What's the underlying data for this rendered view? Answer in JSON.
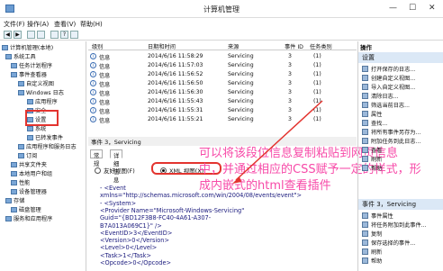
{
  "window": {
    "title": "计算机管理",
    "minimize": "—",
    "maximize": "☐",
    "close": "✕"
  },
  "menu": [
    "文件(F)",
    "操作(A)",
    "查看(V)",
    "帮助(H)"
  ],
  "tree": [
    "计算机管理(本地)",
    "系统工具",
    "任务计划程序",
    "事件查看器",
    "自定义视图",
    "Windows 日志",
    "应用程序",
    "安全",
    "设置",
    "系统",
    "已转发事件",
    "应用程序和服务日志",
    "订阅",
    "共享文件夹",
    "本地用户和组",
    "性能",
    "设备管理器",
    "存储",
    "磁盘管理",
    "服务和应用程序"
  ],
  "grid": {
    "headers": [
      "级别",
      "日期和时间",
      "来源",
      "事件 ID",
      "任务类别"
    ],
    "rows": [
      [
        "信息",
        "2014/6/16 11:58:29",
        "Servicing",
        "3",
        "(1)"
      ],
      [
        "信息",
        "2014/6/16 11:57:03",
        "Servicing",
        "3",
        "(1)"
      ],
      [
        "信息",
        "2014/6/16 11:56:52",
        "Servicing",
        "3",
        "(1)"
      ],
      [
        "信息",
        "2014/6/16 11:56:50",
        "Servicing",
        "3",
        "(1)"
      ],
      [
        "信息",
        "2014/6/16 11:56:30",
        "Servicing",
        "3",
        "(1)"
      ],
      [
        "信息",
        "2014/6/16 11:55:43",
        "Servicing",
        "3",
        "(1)"
      ],
      [
        "信息",
        "2014/6/16 11:55:31",
        "Servicing",
        "3",
        "(1)"
      ],
      [
        "信息",
        "2014/6/16 11:55:21",
        "Servicing",
        "3",
        "(1)"
      ]
    ]
  },
  "detail": {
    "header": "事件 3，Servicing",
    "tabs": [
      "常规",
      "详细信息"
    ],
    "radio_friendly": "友好视图(F)",
    "radio_xml": "XML 视图(X)"
  },
  "xml_lines": [
    "- <Event",
    "  xmlns=\"http://schemas.microsoft.com/win/2004/08/events/event\">",
    "- <System>",
    "    <Provider Name=\"Microsoft-Windows-Servicing\"",
    "     Guid=\"{BD12F3B8-FC40-4A61-A307-",
    "     B7A013A069C1}\" />",
    "    <EventID>3</EventID>",
    "    <Version>0</Version>",
    "    <Level>0</Level>",
    "    <Task>1</Task>",
    "    <Opcode>0</Opcode>"
  ],
  "overlay": [
    "可以将该段位信息复制粘贴到网页信息",
    "中，并通过相应的CSS赋予一定的样式，形",
    "成内嵌式的html查看插件"
  ],
  "actions": {
    "label": "操作",
    "section1": "设置",
    "items1": [
      "打开保存的日志...",
      "创建自定义视图...",
      "导入自定义视图...",
      "清除日志...",
      "筛选当前日志...",
      "属性",
      "查找...",
      "将所有事件另存为...",
      "附加任务到此日志...",
      "查看",
      "刷新",
      "帮助"
    ],
    "section2": "事件 3，Servicing",
    "items2": [
      "事件属性",
      "将任务附加到此事件...",
      "复制",
      "保存选择的事件...",
      "刷新",
      "帮助"
    ]
  },
  "colors": {
    "overlay_text": "#f74aa8",
    "highlight_box": "#e3342f",
    "action_header": "#dbe8f6"
  }
}
